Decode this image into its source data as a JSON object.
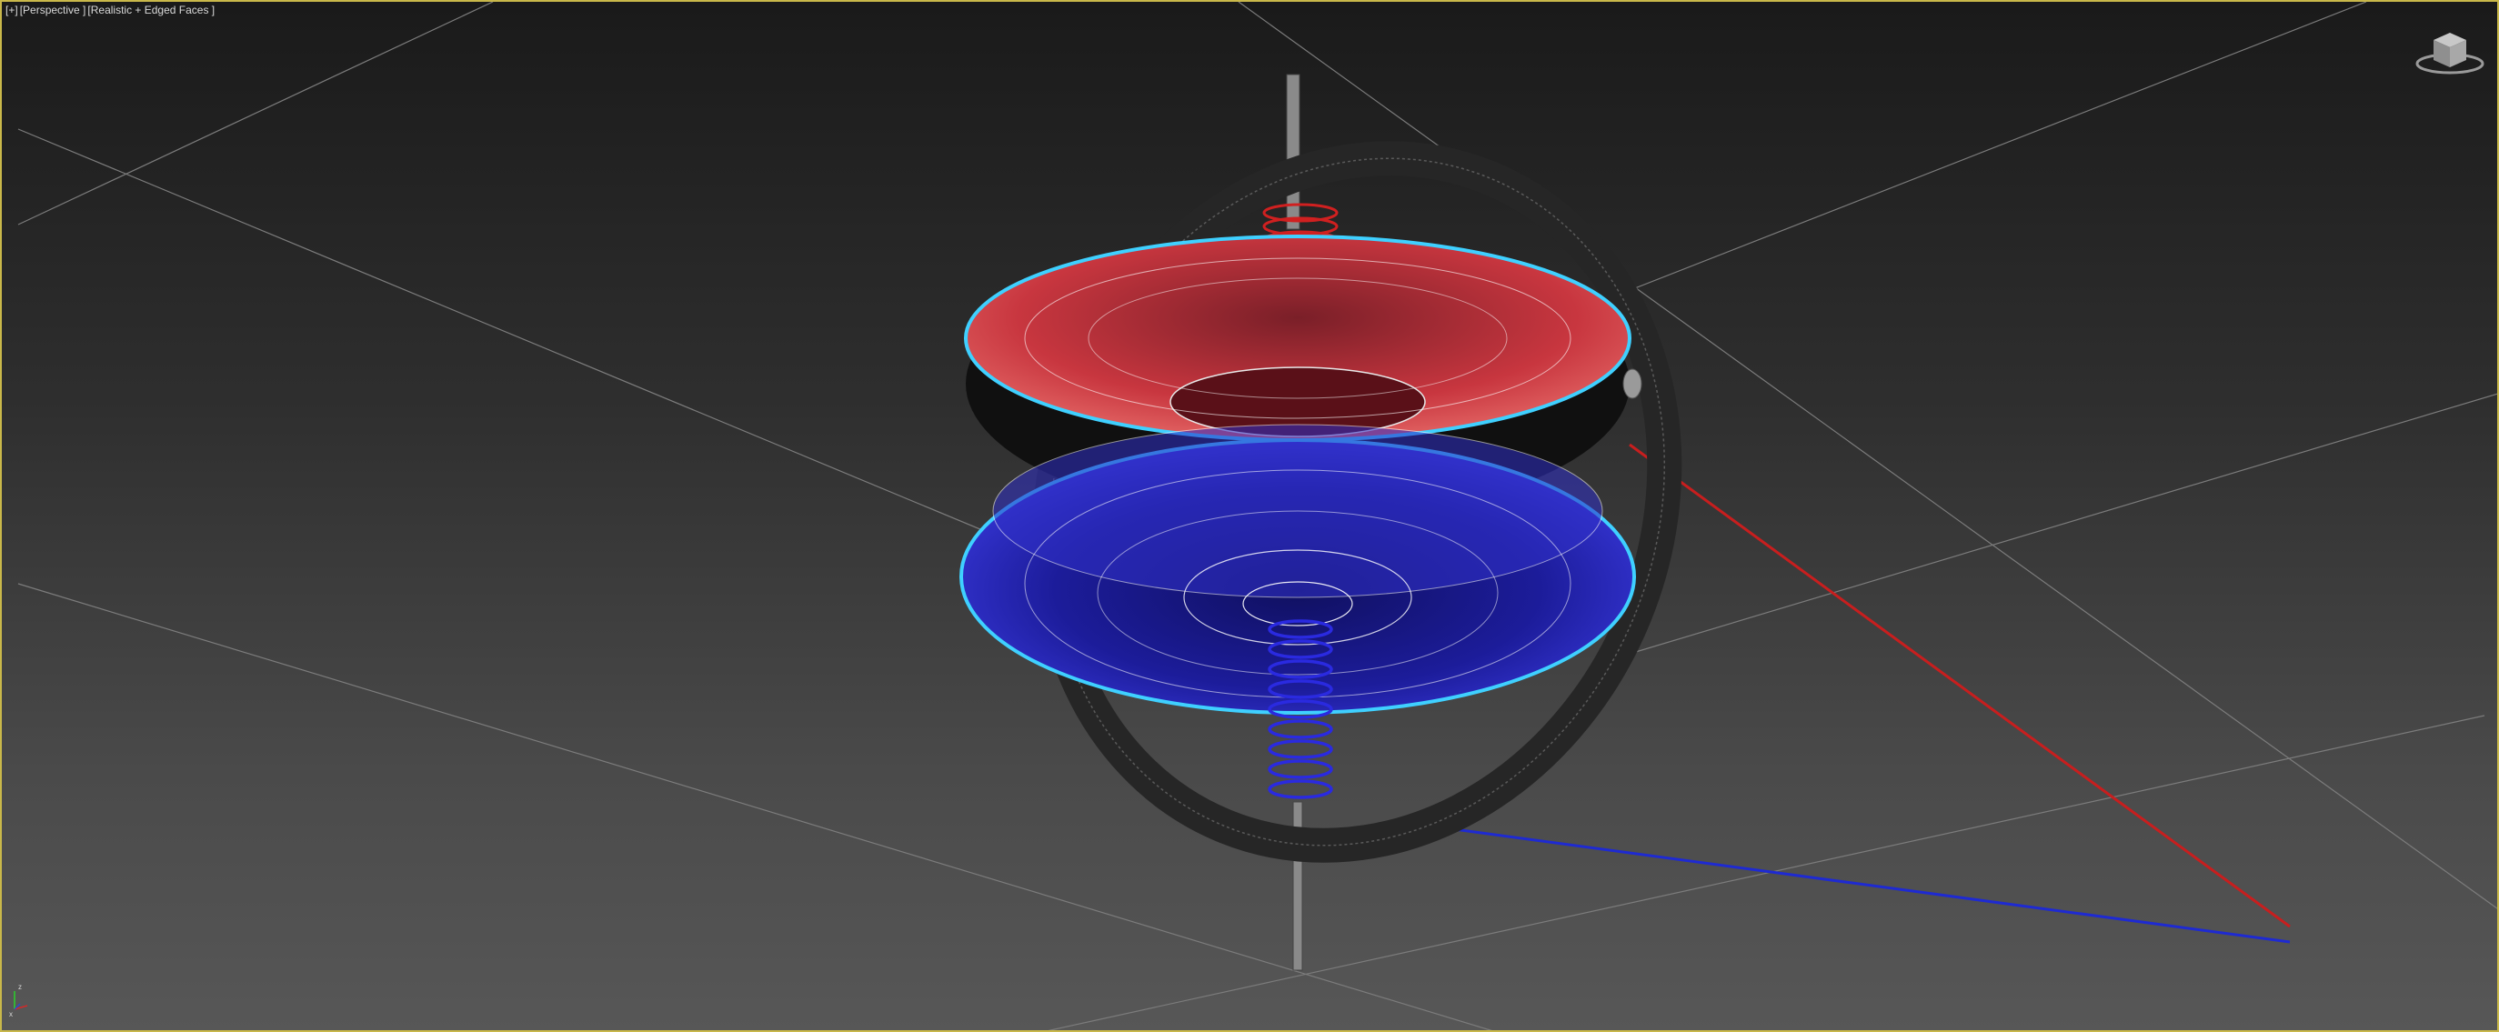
{
  "viewport": {
    "label_plus": "[+]",
    "label_view": "[Perspective ]",
    "label_shading": "[Realistic + Edged Faces ]"
  },
  "colors": {
    "border_active": "#c9b84a",
    "selection_outline": "#3fd0ff",
    "red_part": "#c8283a",
    "blue_part": "#2a2ac8",
    "ring": "#2e2e2e",
    "grid": "#8a8a8a",
    "axis_x": "#c81e1e",
    "axis_z": "#1e2ad2"
  },
  "icons": {
    "viewcube": "viewcube-icon",
    "axis_tripod": "axis-tripod-icon"
  },
  "axis_tripod": {
    "label_z": "z",
    "label_x": "x"
  }
}
